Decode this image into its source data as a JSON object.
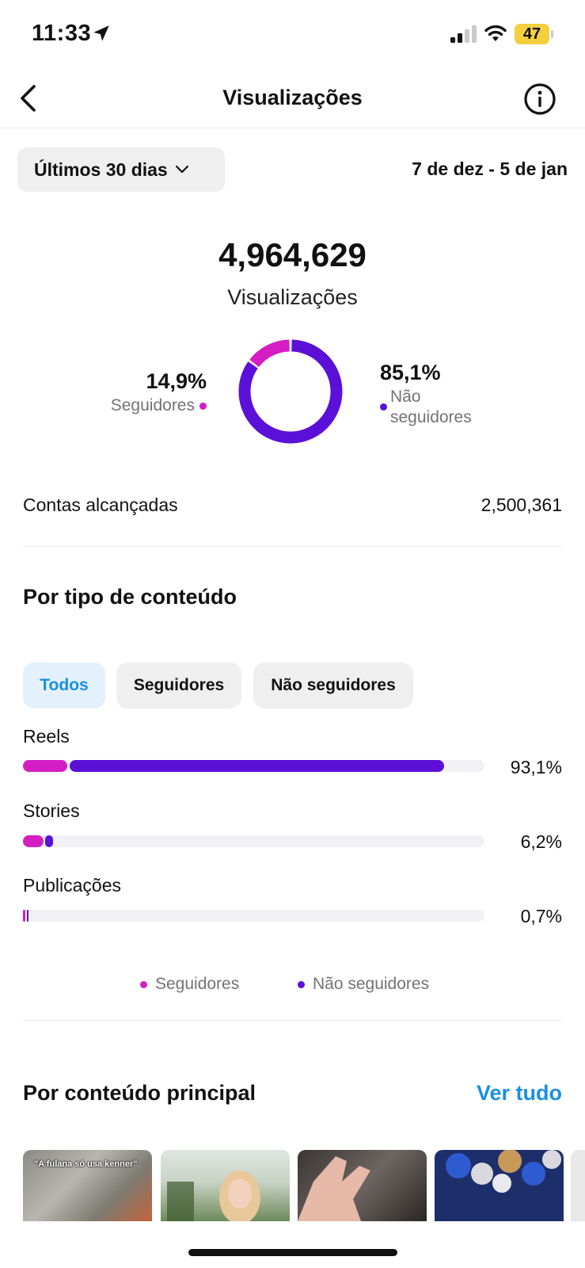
{
  "status_bar": {
    "time": "11:33",
    "battery": "47"
  },
  "nav": {
    "title": "Visualizações"
  },
  "filter": {
    "period": "Últimos 30 dias",
    "date_range": "7 de dez - 5 de jan"
  },
  "summary": {
    "total": "4,964,629",
    "total_label": "Visualizações",
    "followers_pct": "14,9%",
    "followers_label": "Seguidores",
    "non_followers_pct": "85,1%",
    "non_followers_label": "Não seguidores",
    "followers_fraction": 0.149,
    "non_followers_fraction": 0.851
  },
  "reach": {
    "label": "Contas alcançadas",
    "value": "2,500,361"
  },
  "content_type": {
    "title": "Por tipo de conteúdo",
    "tabs": [
      {
        "label": "Todos",
        "active": true
      },
      {
        "label": "Seguidores",
        "active": false
      },
      {
        "label": "Não seguidores",
        "active": false
      }
    ],
    "rows": [
      {
        "label": "Reels",
        "pct": "93,1%",
        "value": 93.1
      },
      {
        "label": "Stories",
        "pct": "6,2%",
        "value": 6.2
      },
      {
        "label": "Publicações",
        "pct": "0,7%",
        "value": 0.7
      }
    ],
    "legend": {
      "followers": "Seguidores",
      "non_followers": "Não seguidores"
    }
  },
  "top_content": {
    "title": "Por conteúdo principal",
    "see_all": "Ver tudo",
    "thumb_caption": "\"A fulana só usa kenner\""
  },
  "colors": {
    "followers": "#d41ec4",
    "non_followers": "#5b10d8",
    "accent": "#1a8fe3"
  }
}
